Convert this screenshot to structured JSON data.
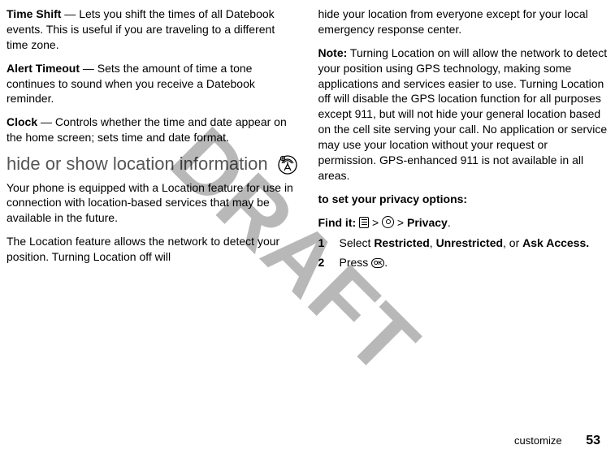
{
  "watermark": "DRAFT",
  "left": {
    "p1_label": "Time Shift",
    "p1_text": " — Lets you shift the times of all Datebook events. This is useful if you are traveling to a different time zone.",
    "p2_label": "Alert Timeout",
    "p2_text": " — Sets the amount of time a tone continues to sound when you receive a Datebook reminder.",
    "p3_label": "Clock",
    "p3_text": " — Controls whether the time and date appear on the home screen; sets time and date format.",
    "section_title": "hide or show location information",
    "p4": "Your phone is equipped with a Location feature for use in connection with location-based services that may be available in the future.",
    "p5": "The Location feature allows the network to detect your position. Turning Location off will"
  },
  "right": {
    "p1": "hide your location from everyone except for your local emergency response center.",
    "note_label": "Note:",
    "note_text": " Turning Location on will allow the network to detect your position using GPS technology, making some applications and services easier to use. Turning Location off will disable the GPS location function for all purposes except 911, but will not hide your general location based on the cell site serving your call. No application or service may use your location without your request or permission. GPS-enhanced 911 is not available in all areas.",
    "subhead": "to set your privacy options:",
    "find_label": "Find it: ",
    "find_sep1": " > ",
    "find_sep2": " > ",
    "find_end": "Privacy",
    "step1_num": "1",
    "step1_a": "Select ",
    "step1_b": "Restricted",
    "step1_c": ", ",
    "step1_d": "Unrestricted",
    "step1_e": ", or ",
    "step1_f": "Ask Access.",
    "step2_num": "2",
    "step2_a": "Press ",
    "step2_b": ".",
    "ok_label": "OK"
  },
  "footer": {
    "section": "customize",
    "page": "53"
  }
}
